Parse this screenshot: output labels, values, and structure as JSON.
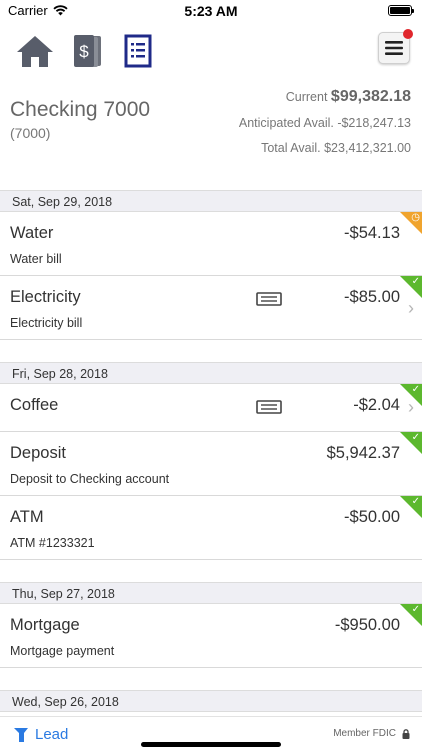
{
  "status": {
    "carrier": "Carrier",
    "time": "5:23 AM"
  },
  "toolbar": {
    "icons": [
      "home-icon",
      "statements-icon",
      "document-list-icon",
      "hamburger-menu-icon"
    ]
  },
  "account": {
    "name": "Checking 7000",
    "number": "(7000)",
    "current_label": "Current",
    "current_value": "$99,382.18",
    "anticipated": "Anticipated Avail. -$218,247.13",
    "total": "Total Avail. $23,412,321.00"
  },
  "groups": [
    {
      "date": "Sat, Sep 29, 2018",
      "items": [
        {
          "name": "Water",
          "amount": "-$54.13",
          "desc": "Water bill"
        },
        {
          "name": "Electricity",
          "amount": "-$85.00",
          "desc": "Electricity bill"
        }
      ]
    },
    {
      "date": "Fri, Sep 28, 2018",
      "items": [
        {
          "name": "Coffee",
          "amount": "-$2.04",
          "desc": ""
        },
        {
          "name": "Deposit",
          "amount": "$5,942.37",
          "desc": "Deposit to Checking account"
        },
        {
          "name": "ATM",
          "amount": "-$50.00",
          "desc": "ATM #1233321"
        }
      ]
    },
    {
      "date": "Thu, Sep 27, 2018",
      "items": [
        {
          "name": "Mortgage",
          "amount": "-$950.00",
          "desc": "Mortgage payment"
        }
      ]
    },
    {
      "date": "Wed, Sep 26, 2018",
      "items": []
    }
  ],
  "colors": {
    "cleared": "#5cb82e",
    "pending": "#f0a42e",
    "brand": "#2a7ae2",
    "notify": "#e0262c"
  },
  "footer": {
    "brand": "Lead",
    "fdic": "Member FDIC"
  }
}
